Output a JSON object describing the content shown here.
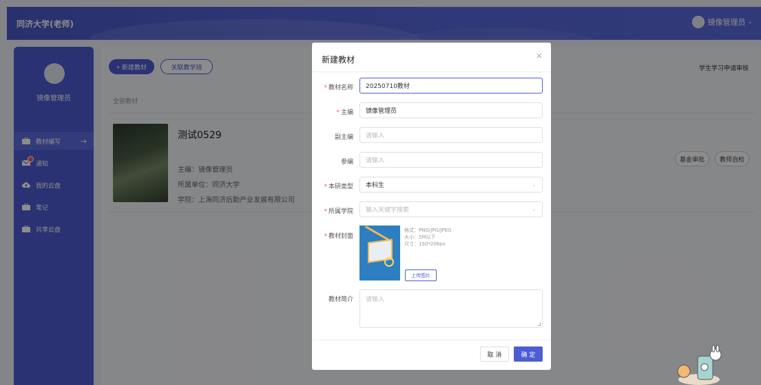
{
  "header": {
    "brand": "同济大学(老师)",
    "user": "镜像管理员"
  },
  "sidebar": {
    "user_name": "镜像管理员",
    "items": [
      {
        "label": "教材编写",
        "icon": "briefcase-icon",
        "active": true
      },
      {
        "label": "通知",
        "icon": "mail-icon",
        "badge": true
      },
      {
        "label": "我的云盘",
        "icon": "cloud-upload-icon"
      },
      {
        "label": "笔记",
        "icon": "briefcase-icon"
      },
      {
        "label": "共享云盘",
        "icon": "briefcase-icon"
      }
    ]
  },
  "main": {
    "new_button": "+ 新建教材",
    "assoc_button": "关联教学班",
    "review_link": "学生学习申请审核",
    "all_label": "全部教材",
    "book": {
      "title": "测试0529",
      "editor": "主编：镜像管理员",
      "unit": "所属单位：同济大学",
      "college": "学院：上海同济后勤产业发展有限公司"
    },
    "pills": [
      "基金审批",
      "教师自检"
    ]
  },
  "modal": {
    "title": "新建教材",
    "close": "×",
    "fields": {
      "name": {
        "label": "教材名称",
        "value": "20250710教材"
      },
      "editor": {
        "label": "主编",
        "value": "镜像管理员"
      },
      "vice_editor": {
        "label": "副主编",
        "placeholder": "请输入"
      },
      "participant": {
        "label": "参编",
        "placeholder": "请输入"
      },
      "type": {
        "label": "本研类型",
        "value": "本科生"
      },
      "college": {
        "label": "所属学院",
        "placeholder": "输入关键字搜索"
      },
      "cover": {
        "label": "教材封面",
        "hint_format": "格式：PNG/JPG/JPEG",
        "hint_size": "大小：5M以下",
        "hint_dims": "尺寸：150*206px",
        "upload": "上传图片"
      },
      "intro": {
        "label": "教材简介",
        "placeholder": "请输入"
      }
    },
    "cancel": "取 消",
    "confirm": "确 定"
  }
}
